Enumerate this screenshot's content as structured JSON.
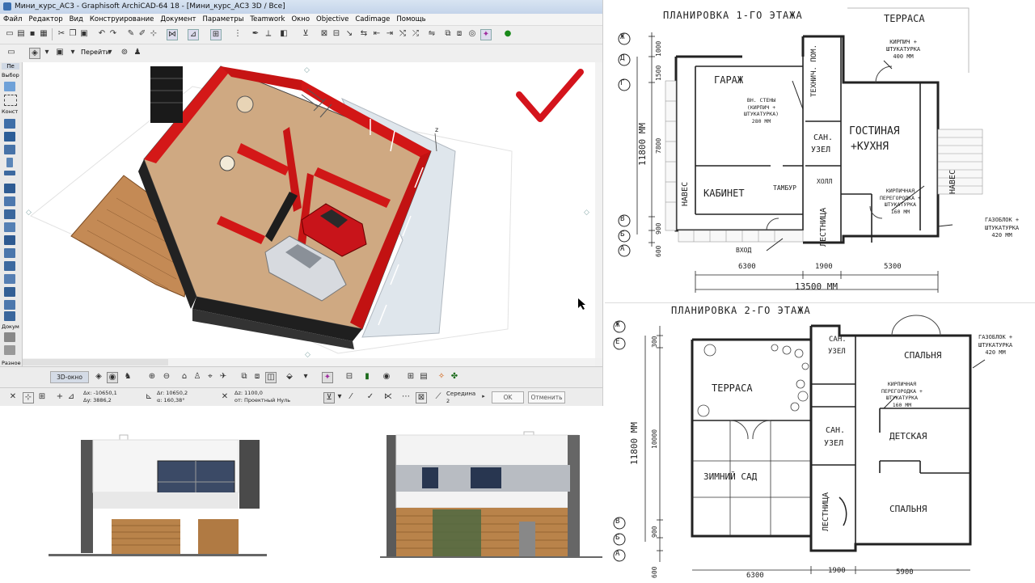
{
  "window": {
    "title": "Мини_курс_АС3 - Graphisoft ArchiCAD-64 18 - [Мини_курс_АС3 3D / Все]",
    "menu": [
      "Файл",
      "Редактор",
      "Вид",
      "Конструирование",
      "Документ",
      "Параметры",
      "Teamwork",
      "Окно",
      "Objective",
      "Cadimage",
      "Помощь"
    ]
  },
  "toolbar": {
    "goto_label": "Перейти"
  },
  "toolbox": {
    "tab_label": "Пе",
    "select_label": "Выбор",
    "construct_label": "Конст",
    "document_label": "Докум",
    "misc_label": "Разное"
  },
  "view3d": {
    "zaxis_label": "z"
  },
  "bottom": {
    "view_button": "3D-окно",
    "dx": "Δx: -10650,1",
    "dy": "Δy: 3886,2",
    "a_dist": "Δr: 10650,2",
    "a_angle": "α: 160,38°",
    "dz": "Δz: 1100,0",
    "ref": "от: Проектный Нуль",
    "mid_label": "Середина",
    "mid_value": "2",
    "ok": "OK",
    "cancel": "Отменить"
  },
  "plan1": {
    "title": "ПЛАНИРОВКА 1-ГО ЭТАЖА",
    "rooms": {
      "garage": "ГАРАЖ",
      "tech": "ТЕХНИЧ. ПОМ.",
      "terrace": "ТЕРРАСА",
      "living": "ГОСТИНАЯ",
      "kitchen": "+КУХНЯ",
      "bath1": "САН.",
      "bath2": "УЗЕЛ",
      "cabinet": "КАБИНЕТ",
      "tambur": "ТАМБУР",
      "hall": "ХОЛЛ",
      "stairs": "ЛЕСТНИЦА",
      "naves_l": "НАВЕС",
      "naves_r": "НАВЕС",
      "entry": "ВХОД"
    },
    "notes": {
      "brick_top_1": "КИРПИЧ +",
      "brick_top_2": "ШТУКАТУРКА",
      "brick_top_3": "400 ММ",
      "inner_1": "ВН. СТЕНЫ",
      "inner_2": "(КИРПИЧ +",
      "inner_3": "ШТУКАТУРКА)",
      "inner_4": "280 ММ",
      "part_1": "КИРПИЧНАЯ",
      "part_2": "ПЕРЕГОРОДКА +",
      "part_3": "ШТУКАТУРКА",
      "part_4": "160 ММ",
      "gas_1": "ГАЗОБЛОК +",
      "gas_2": "ШТУКАТУРКА",
      "gas_3": "420 ММ"
    },
    "axes": [
      "Ж",
      "Д",
      "Г",
      "В",
      "Б",
      "А"
    ],
    "vdims": [
      "1000",
      "1500",
      "7800",
      "900",
      "600"
    ],
    "total_v": "11800 ММ",
    "hdims": [
      "6300",
      "1900",
      "5300"
    ],
    "total_h": "13500 ММ"
  },
  "plan2": {
    "title": "ПЛАНИРОВКА 2-ГО ЭТАЖА",
    "rooms": {
      "terrace": "ТЕРРАСА",
      "winter": "ЗИМНИЙ САД",
      "bath_a1": "САН.",
      "bath_a2": "УЗЕЛ",
      "bath_b1": "САН.",
      "bath_b2": "УЗЕЛ",
      "bed1": "СПАЛЬНЯ",
      "kids": "ДЕТСКАЯ",
      "bed2": "СПАЛЬНЯ",
      "stairs": "ЛЕСТНИЦА"
    },
    "notes": {
      "gas_1": "ГАЗОБЛОК +",
      "gas_2": "ШТУКАТУРКА",
      "gas_3": "420 ММ",
      "part_1": "КИРПИЧНАЯ",
      "part_2": "ПЕРЕГОРОДКА +",
      "part_3": "ШТУКАТУРКА",
      "part_4": "160 ММ"
    },
    "axes": [
      "Ж",
      "Е",
      "В",
      "Б",
      "А"
    ],
    "vdims": [
      "300",
      "10000",
      "900",
      "600"
    ],
    "total_v": "11800 ММ",
    "hdims": [
      "6300",
      "1900",
      "5900"
    ]
  },
  "colors": {
    "wall_red": "#d01010",
    "floor": "#c9a37c",
    "check": "#d4141c",
    "wood": "#b9834a"
  }
}
